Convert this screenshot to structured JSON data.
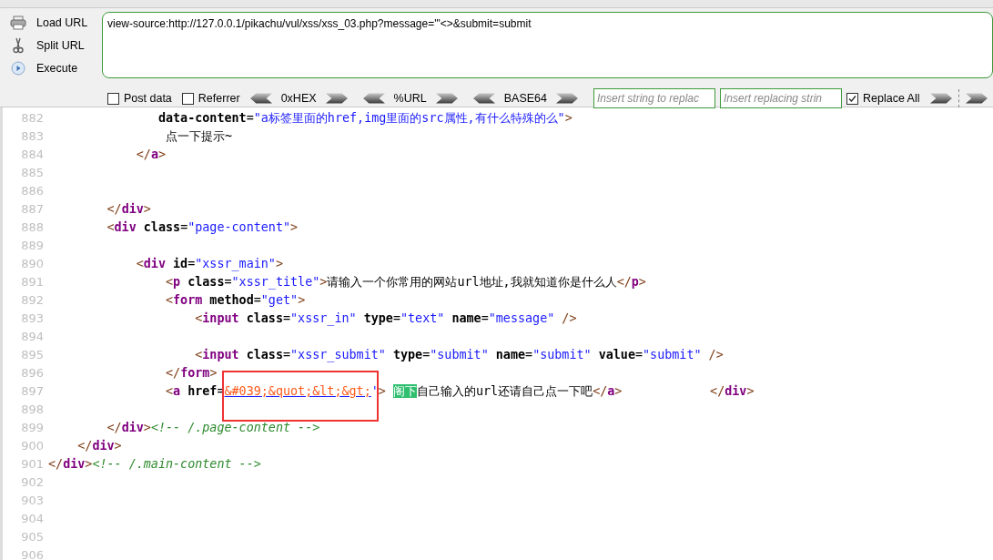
{
  "toolbar": {
    "actions": [
      {
        "kind": "load",
        "label": "Load URL"
      },
      {
        "kind": "split",
        "label": "Split URL"
      },
      {
        "kind": "execute",
        "label": "Execute"
      }
    ],
    "url": "view-source:http://127.0.0.1/pikachu/vul/xss/xss_03.php?message='\"<>&submit=submit",
    "options": [
      {
        "label": "Post data",
        "checked": false
      },
      {
        "label": "Referrer",
        "checked": false
      }
    ],
    "encoders": [
      "0xHEX",
      "%URL",
      "BASE64"
    ],
    "replace_from": {
      "placeholder": "Insert string to replac"
    },
    "replace_to": {
      "placeholder": "Insert replacing strin"
    },
    "replace_all": {
      "label": "Replace All",
      "checked": true
    }
  },
  "source": {
    "lines": [
      {
        "number": "882",
        "tokens": [
          {
            "kind": "attr",
            "text": "               data-content"
          },
          {
            "kind": "eq",
            "text": "="
          },
          {
            "kind": "value",
            "text": "\"a标签里面的href,img里面的src属性,有什么特殊的么\""
          },
          {
            "kind": "punct",
            "text": ">"
          }
        ]
      },
      {
        "number": "883",
        "tokens": [
          {
            "kind": "text",
            "text": "                点一下提示~"
          }
        ]
      },
      {
        "number": "884",
        "tokens": [
          {
            "kind": "punct",
            "text": "            </"
          },
          {
            "kind": "tag",
            "text": "a"
          },
          {
            "kind": "punct",
            "text": ">"
          }
        ]
      },
      {
        "number": "885"
      },
      {
        "number": "886"
      },
      {
        "number": "887",
        "tokens": [
          {
            "kind": "punct",
            "text": "        </"
          },
          {
            "kind": "tag",
            "text": "div"
          },
          {
            "kind": "punct",
            "text": ">"
          }
        ]
      },
      {
        "number": "888",
        "tokens": [
          {
            "kind": "punct",
            "text": "        <"
          },
          {
            "kind": "tag",
            "text": "div"
          },
          {
            "kind": "attr",
            "text": " class"
          },
          {
            "kind": "eq",
            "text": "="
          },
          {
            "kind": "value",
            "text": "\"page-content\""
          },
          {
            "kind": "punct",
            "text": ">"
          }
        ]
      },
      {
        "number": "889"
      },
      {
        "number": "890",
        "tokens": [
          {
            "kind": "punct",
            "text": "            <"
          },
          {
            "kind": "tag",
            "text": "div"
          },
          {
            "kind": "attr",
            "text": " id"
          },
          {
            "kind": "eq",
            "text": "="
          },
          {
            "kind": "value",
            "text": "\"xssr_main\""
          },
          {
            "kind": "punct",
            "text": ">"
          }
        ]
      },
      {
        "number": "891",
        "tokens": [
          {
            "kind": "punct",
            "text": "                <"
          },
          {
            "kind": "tag",
            "text": "p"
          },
          {
            "kind": "attr",
            "text": " class"
          },
          {
            "kind": "eq",
            "text": "="
          },
          {
            "kind": "value",
            "text": "\"xssr_title\""
          },
          {
            "kind": "punct",
            "text": ">"
          },
          {
            "kind": "text",
            "text": "请输入一个你常用的网站url地址,我就知道你是什么人"
          },
          {
            "kind": "punct",
            "text": "</"
          },
          {
            "kind": "tag",
            "text": "p"
          },
          {
            "kind": "punct",
            "text": ">"
          }
        ]
      },
      {
        "number": "892",
        "tokens": [
          {
            "kind": "punct",
            "text": "                <"
          },
          {
            "kind": "tag",
            "text": "form"
          },
          {
            "kind": "attr",
            "text": " method"
          },
          {
            "kind": "eq",
            "text": "="
          },
          {
            "kind": "value",
            "text": "\"get\""
          },
          {
            "kind": "punct",
            "text": ">"
          }
        ]
      },
      {
        "number": "893",
        "tokens": [
          {
            "kind": "punct",
            "text": "                    <"
          },
          {
            "kind": "tag",
            "text": "input"
          },
          {
            "kind": "attr",
            "text": " class"
          },
          {
            "kind": "eq",
            "text": "="
          },
          {
            "kind": "value",
            "text": "\"xssr_in\""
          },
          {
            "kind": "attr",
            "text": " type"
          },
          {
            "kind": "eq",
            "text": "="
          },
          {
            "kind": "value",
            "text": "\"text\""
          },
          {
            "kind": "attr",
            "text": " name"
          },
          {
            "kind": "eq",
            "text": "="
          },
          {
            "kind": "value",
            "text": "\"message\""
          },
          {
            "kind": "punct",
            "text": " />"
          }
        ]
      },
      {
        "number": "894"
      },
      {
        "number": "895",
        "tokens": [
          {
            "kind": "punct",
            "text": "                    <"
          },
          {
            "kind": "tag",
            "text": "input"
          },
          {
            "kind": "attr",
            "text": " class"
          },
          {
            "kind": "eq",
            "text": "="
          },
          {
            "kind": "value",
            "text": "\"xssr_submit\""
          },
          {
            "kind": "attr",
            "text": " type"
          },
          {
            "kind": "eq",
            "text": "="
          },
          {
            "kind": "value",
            "text": "\"submit\""
          },
          {
            "kind": "attr",
            "text": " name"
          },
          {
            "kind": "eq",
            "text": "="
          },
          {
            "kind": "value",
            "text": "\"submit\""
          },
          {
            "kind": "attr",
            "text": " value"
          },
          {
            "kind": "eq",
            "text": "="
          },
          {
            "kind": "value",
            "text": "\"submit\""
          },
          {
            "kind": "punct",
            "text": " />"
          }
        ]
      },
      {
        "number": "896",
        "tokens": [
          {
            "kind": "punct",
            "text": "                </"
          },
          {
            "kind": "tag",
            "text": "form"
          },
          {
            "kind": "punct",
            "text": ">"
          }
        ]
      },
      {
        "number": "897",
        "tokens": [
          {
            "kind": "punct",
            "text": "                <"
          },
          {
            "kind": "tag",
            "text": "a"
          },
          {
            "kind": "attr",
            "text": " href"
          },
          {
            "kind": "eq",
            "text": "="
          },
          {
            "kind": "link",
            "text": "&#039;&quot;&lt;&gt;",
            "boxed": true
          },
          {
            "kind": "value",
            "text": "'"
          },
          {
            "kind": "punct",
            "text": "> "
          },
          {
            "kind": "highlight",
            "text": "阁下"
          },
          {
            "kind": "text",
            "text": "自己输入的url还请自己点一下吧"
          },
          {
            "kind": "punct",
            "text": "</"
          },
          {
            "kind": "tag",
            "text": "a"
          },
          {
            "kind": "punct",
            "text": ">            </"
          },
          {
            "kind": "tag",
            "text": "div"
          },
          {
            "kind": "punct",
            "text": ">"
          }
        ]
      },
      {
        "number": "898"
      },
      {
        "number": "899",
        "tokens": [
          {
            "kind": "punct",
            "text": "        </"
          },
          {
            "kind": "tag",
            "text": "div"
          },
          {
            "kind": "punct",
            "text": ">"
          },
          {
            "kind": "comment",
            "text": "<!-- /.page-content -->"
          }
        ]
      },
      {
        "number": "900",
        "tokens": [
          {
            "kind": "punct",
            "text": "    </"
          },
          {
            "kind": "tag",
            "text": "div"
          },
          {
            "kind": "punct",
            "text": ">"
          }
        ]
      },
      {
        "number": "901",
        "tokens": [
          {
            "kind": "punct",
            "text": "</"
          },
          {
            "kind": "tag",
            "text": "div"
          },
          {
            "kind": "punct",
            "text": ">"
          },
          {
            "kind": "comment",
            "text": "<!-- /.main-content -->"
          }
        ]
      },
      {
        "number": "902"
      },
      {
        "number": "903"
      },
      {
        "number": "904"
      },
      {
        "number": "905"
      },
      {
        "number": "906"
      }
    ]
  }
}
